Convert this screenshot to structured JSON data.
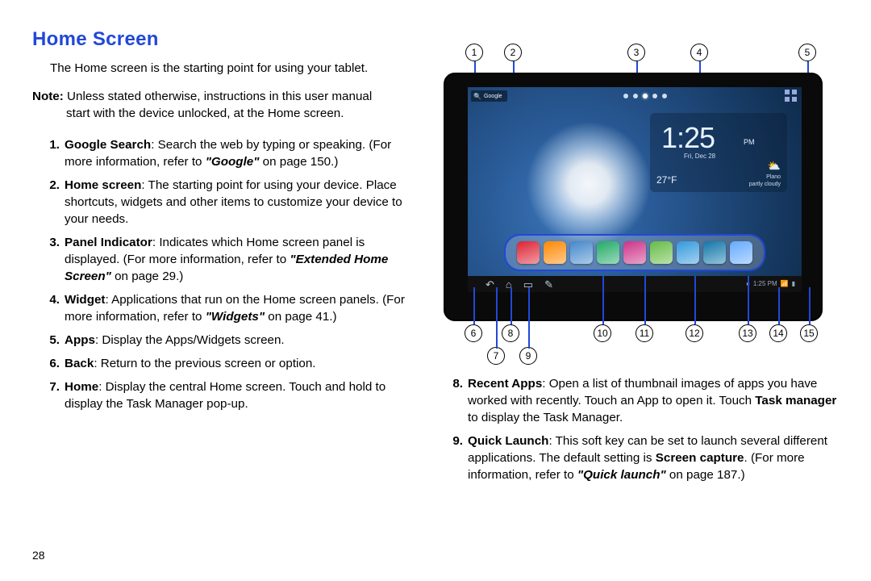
{
  "heading": "Home Screen",
  "intro": "The Home screen is the starting point for using your tablet.",
  "note_label": "Note:",
  "note_rest1": " Unless stated otherwise, instructions in this user manual",
  "note_line2": "start with the device unlocked, at the Home screen.",
  "page_number": "28",
  "left_items": [
    {
      "n": "1.",
      "term": "Google Search",
      "rest": ": Search the web by typing or speaking. (For more information, refer to ",
      "xref": "\"Google\"",
      "tail": " on page 150.)"
    },
    {
      "n": "2.",
      "term": "Home screen",
      "rest": ": The starting point for using your device. Place shortcuts, widgets and other items to customize your device to your needs."
    },
    {
      "n": "3.",
      "term": "Panel Indicator",
      "rest": ": Indicates which Home screen panel is displayed. (For more information, refer to ",
      "xref": "\"Extended Home Screen\"",
      "tail": " on page 29.)"
    },
    {
      "n": "4.",
      "term": "Widget",
      "rest": ": Applications that run on the Home screen panels. (For more information, refer to ",
      "xref": "\"Widgets\"",
      "tail": " on page 41.)"
    },
    {
      "n": "5.",
      "term": "Apps",
      "rest": ": Display the Apps/Widgets screen."
    },
    {
      "n": "6.",
      "term": "Back",
      "rest": ": Return to the previous screen or option."
    },
    {
      "n": "7.",
      "term": "Home",
      "rest": ": Display the central Home screen. Touch and hold to display the Task Manager pop-up."
    }
  ],
  "right_items": [
    {
      "n": "8.",
      "term": "Recent Apps",
      "rest": ": Open a list of thumbnail images of apps you have worked with recently. Touch an App to open it. Touch ",
      "bold2": "Task manager",
      "tail": " to display the Task Manager."
    },
    {
      "n": "9.",
      "term": "Quick Launch",
      "rest": ": This soft key can be set to launch several different applications. The default setting is ",
      "bold2": "Screen capture",
      "rest2": ". (For more information, refer to ",
      "xref": "\"Quick launch\"",
      "tail": " on page 187.)"
    }
  ],
  "callouts_top": {
    "c1": "1",
    "c2": "2",
    "c3": "3",
    "c4": "4",
    "c5": "5"
  },
  "callouts_bot": {
    "c6": "6",
    "c7": "7",
    "c8": "8",
    "c9": "9",
    "c10": "10",
    "c11": "11",
    "c12": "12",
    "c13": "13",
    "c14": "14",
    "c15": "15"
  },
  "screen": {
    "search_label": "Google",
    "time": "1:25",
    "ampm": "PM",
    "date": "Fri, Dec 28",
    "temp": "27°F",
    "city": "Plano",
    "cond": "partly cloudy",
    "statusbar_time": "1:25 PM"
  },
  "dock_colors": [
    "#d23",
    "#f80",
    "#48c",
    "#2a6",
    "#c38",
    "#6b4",
    "#39d",
    "#17a",
    "#6af"
  ]
}
